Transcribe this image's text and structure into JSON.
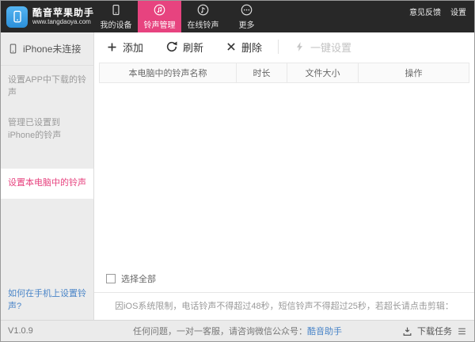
{
  "app": {
    "title": "酷音苹果助手",
    "website": "www.tangdaoya.com"
  },
  "colors": {
    "accent_pink": "#e7437f",
    "topbar_dark": "#282828",
    "link_blue": "#4a85c8",
    "logo_blue": "#2b8fd9"
  },
  "topbar": {
    "tabs": [
      {
        "label": "我的设备",
        "icon": "smartphone-icon",
        "active": false
      },
      {
        "label": "铃声管理",
        "icon": "music-note-circle-icon",
        "active": true
      },
      {
        "label": "在线铃声",
        "icon": "music-note-circle-icon",
        "active": false
      },
      {
        "label": "更多",
        "icon": "ellipsis-circle-icon",
        "active": false
      }
    ],
    "feedback": "意见反馈",
    "settings": "设置"
  },
  "sidebar": {
    "items": [
      {
        "label": "iPhone未连接",
        "icon": "iphone-outline-icon"
      },
      {
        "label": "设置APP中下载的铃声"
      },
      {
        "label": "管理已设置到iPhone的铃声"
      },
      {
        "label": "设置本电脑中的铃声",
        "active": true
      }
    ],
    "help_link": "如何在手机上设置铃声?"
  },
  "toolbar": {
    "add": "添加",
    "refresh": "刷新",
    "delete": "删除",
    "one_click": "一键设置"
  },
  "table": {
    "headers": [
      "本电脑中的铃声名称",
      "时长",
      "文件大小",
      "操作"
    ],
    "rows": []
  },
  "footer": {
    "select_all": "选择全部",
    "note": "因iOS系统限制，电话铃声不得超过48秒，短信铃声不得超过25秒，若超长请点击剪辑："
  },
  "statusbar": {
    "version": "V1.0.9",
    "message_prefix": "任何问题，一对一客服，请咨询微信公众号：",
    "message_link": "酷音助手",
    "download": "下载任务"
  },
  "icons": {
    "logo": "phone-in-rounded-square",
    "add": "plus",
    "refresh": "circular-arrow",
    "delete": "x-mark",
    "one_click": "lightning",
    "download": "down-arrow-tray",
    "tasks": "hamburger-lines",
    "select_all": "empty-checkbox"
  }
}
